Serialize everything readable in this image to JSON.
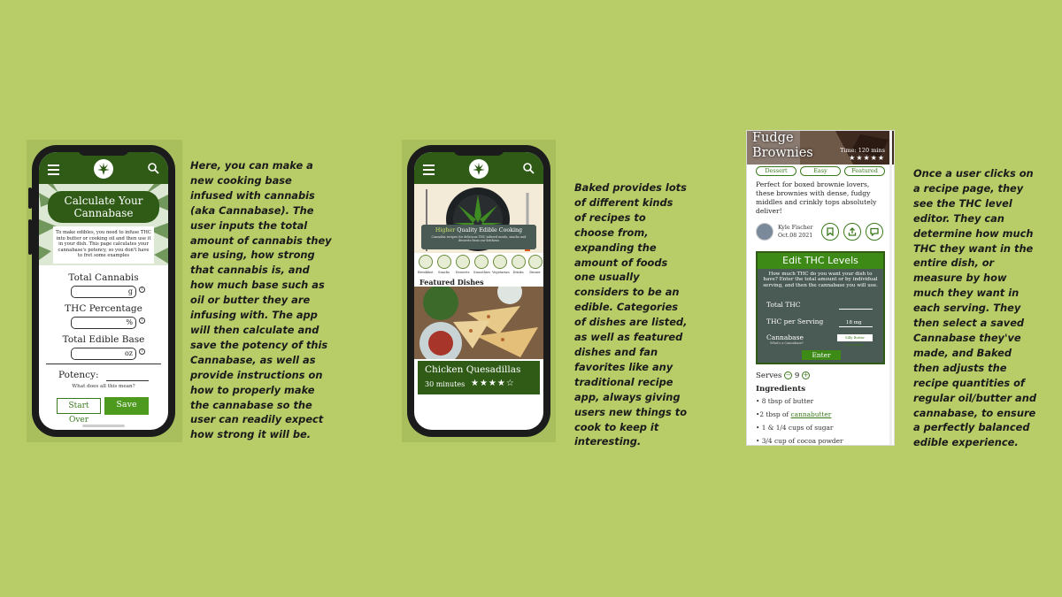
{
  "colors": {
    "background": "#b8cc68",
    "brand_green": "#2f5b17",
    "accent_green": "#4d9a1f",
    "slate": "#4a5a55"
  },
  "phone1": {
    "title": "Calculate Your Cannabase",
    "info": "To make edibles, you need to infuse THC into butter or cooking oil and then use it in your dish. This page calculates your cannabase's potency, so you don't have to fret some examples",
    "fields": [
      {
        "label": "Total Cannabis",
        "unit": "g"
      },
      {
        "label": "THC Percentage",
        "unit": "%"
      },
      {
        "label": "Total Edible Base",
        "unit": "oz"
      }
    ],
    "potency_label": "Potency:",
    "help_text": "What does all this mean?",
    "start_over": "Start Over",
    "save": "Save"
  },
  "desc1": "Here, you can make a new cooking base infused with cannabis (aka Cannabase). The user inputs the total amount of cannabis they are using, how strong that cannabis is, and how much base such as oil or butter they are infusing with. The app will then calculate and save the potency of this Cannabase, as well as provide instructions on how to properly make the cannabase so the user can readily expect how strong it will be.",
  "phone2": {
    "quality_highlight": "Higher",
    "quality_rest": "Quality Edible Cooking",
    "quality_sub": "Cannabis recipes for delicious THC infused meals, snacks and desserts from our kitchens",
    "categories": [
      "Breakfast",
      "Snacks",
      "Desserts",
      "Smoothies",
      "Vegetarian",
      "Drinks",
      "Dinner"
    ],
    "featured_title": "Featured Dishes",
    "dish_name": "Chicken Quesadillas",
    "dish_time": "30 minutes",
    "dish_stars": "★★★★☆"
  },
  "desc2": "Baked provides lots of different kinds of recipes to choose from, expanding the amount of foods one usually considers to be an edible. Categories of dishes are listed, as well as featured dishes and fan favorites like any traditional recipe app, always giving users new things to cook to keep it interesting.",
  "recipe": {
    "title_line1": "Fudge",
    "title_line2": "Brownies",
    "time": "Time: 120 mins",
    "stars": "★★★★★",
    "tags": [
      "Dessert",
      "Easy",
      "Featured"
    ],
    "description": "Perfect for boxed brownie lovers, these brownies with dense, fudgy middles and crinkly tops absolutely deliver!",
    "author": "Kyle Fischer",
    "date": "Oct.08 2021",
    "thc_title": "Edit THC Levels",
    "thc_question": "How much THC do you want your dish to have? Enter the total amount or by individual serving, and then the cannabase you will use.",
    "total_thc": "Total THC",
    "thc_per_serving": "THC per Serving",
    "serving_value": "18 mg",
    "cannabase_label": "Cannabase",
    "cannabase_select": "Silly Butter Cannabase",
    "cannabase_sub": "What's a Cannabase?",
    "enter": "Enter",
    "serves_label": "Serves",
    "serves_count": "9",
    "ingredients_title": "Ingredients",
    "ingredients": [
      "• 8 tbsp of butter",
      "•2 tbsp of ",
      "• 1 & 1/4  cups of sugar",
      "• 3/4 cup of cocoa powder"
    ],
    "cannabutter_link": "cannabutter"
  },
  "desc3": "Once a user clicks on a recipe page, they see the THC level editor. They can determine how much THC they want in the entire dish, or measure by how much they want in each serving. They then select a saved Cannabase they've made, and Baked then adjusts the recipe quantities of regular oil/butter and cannabase, to ensure a perfectly balanced edible experience."
}
